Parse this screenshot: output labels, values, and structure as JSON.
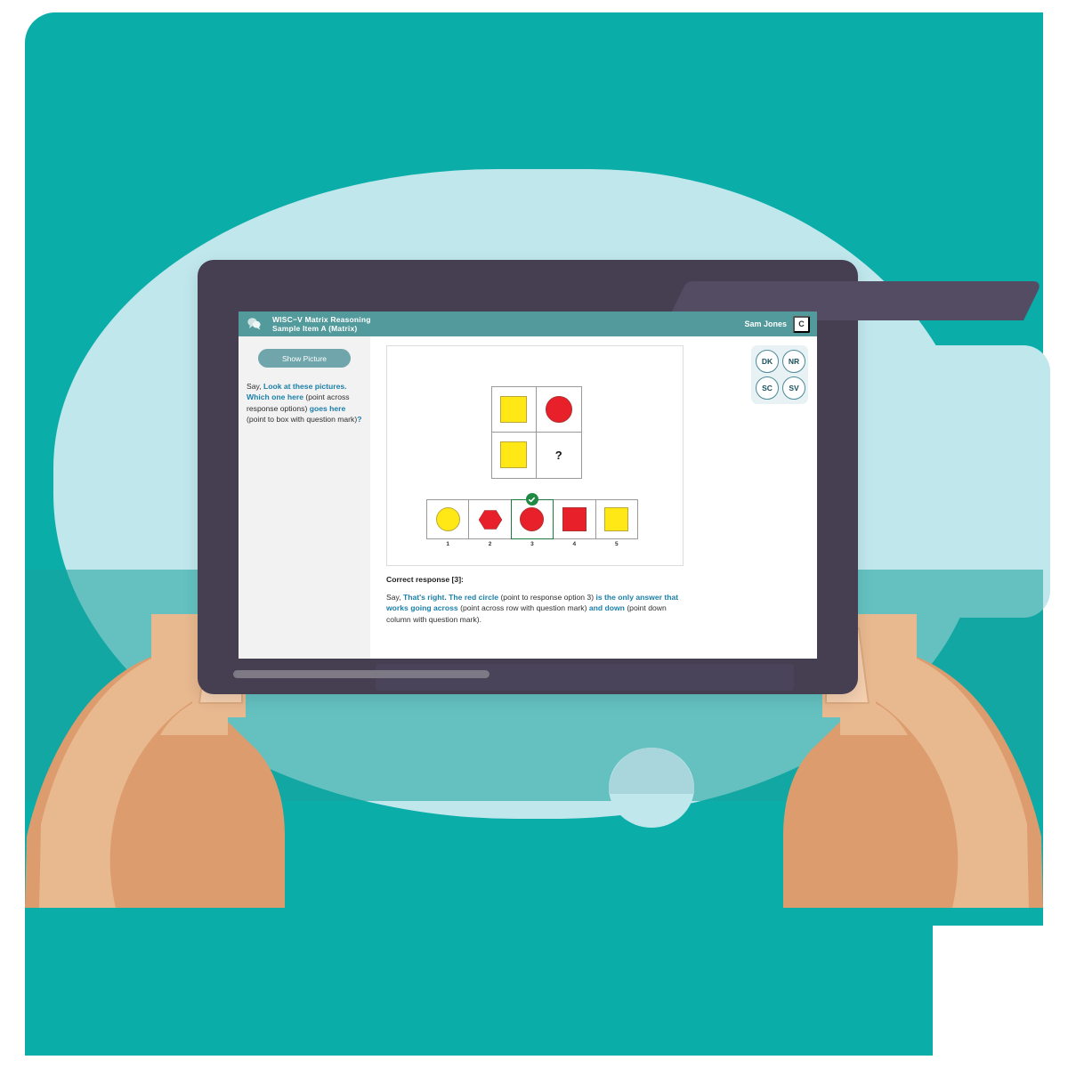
{
  "app": {
    "header": {
      "bubble_icon": "speech-bubble-icon",
      "title_line1": "WISC−V Matrix Reasoning",
      "title_line2": "Sample Item A (Matrix)",
      "examinee_name": "Sam Jones",
      "c_button_label": "C",
      "bar_color": "#529a9b"
    },
    "sidebar": {
      "show_picture_label": "Show Picture",
      "say_prefix": "Say, ",
      "say_segments": [
        {
          "text": "Look at these pictures. Which one here",
          "highlight": true
        },
        {
          "text": " (point across response options) ",
          "highlight": false
        },
        {
          "text": "goes here",
          "highlight": true
        },
        {
          "text": " (point to box with question mark)",
          "highlight": false
        },
        {
          "text": "?",
          "highlight": true
        }
      ]
    },
    "tool_buttons": [
      {
        "label": "DK",
        "name": "dont-know-button"
      },
      {
        "label": "NR",
        "name": "no-response-button"
      },
      {
        "label": "SC",
        "name": "self-correct-button"
      },
      {
        "label": "SV",
        "name": "subvocalization-button"
      }
    ],
    "stimulus": {
      "matrix": {
        "rows": [
          [
            {
              "shape": "square",
              "color": "#ffe815"
            },
            {
              "shape": "circle",
              "color": "#e8202a"
            }
          ],
          [
            {
              "shape": "square",
              "color": "#ffe815"
            },
            {
              "shape": "question",
              "color": "#141414",
              "label": "?"
            }
          ]
        ]
      },
      "options": [
        {
          "number": "1",
          "shape": "circle",
          "color": "#ffe815",
          "selected": false
        },
        {
          "number": "2",
          "shape": "hexagon",
          "color": "#e8202a",
          "selected": false
        },
        {
          "number": "3",
          "shape": "circle",
          "color": "#e8202a",
          "selected": true
        },
        {
          "number": "4",
          "shape": "square",
          "color": "#e8202a",
          "selected": false
        },
        {
          "number": "5",
          "shape": "square",
          "color": "#ffe815",
          "selected": false
        }
      ],
      "selected_option": "3",
      "selection_border_color": "#1c7a3e",
      "check_badge_color": "#1f8a43"
    },
    "feedback": {
      "title": "Correct response [3]:",
      "say_prefix": "Say, ",
      "segments": [
        {
          "text": "That's right. The red circle",
          "highlight": true
        },
        {
          "text": " (point to response option 3) ",
          "highlight": false
        },
        {
          "text": "is the only answer that works going across",
          "highlight": true
        },
        {
          "text": " (point across row with question mark) ",
          "highlight": false
        },
        {
          "text": "and down",
          "highlight": true
        },
        {
          "text": " (point down column with question mark).",
          "highlight": false
        }
      ]
    }
  },
  "theme": {
    "background_teal": "#0bada8",
    "blob_light_blue": "#bfe7ec",
    "tablet_bezel": "#453f51",
    "sidebar_gray": "#f2f2f2",
    "link_blue": "#1b7fa8",
    "skin_light": "#e8b88f",
    "skin_mid": "#dd9c6e",
    "nail_color": "#f4cfb0"
  }
}
